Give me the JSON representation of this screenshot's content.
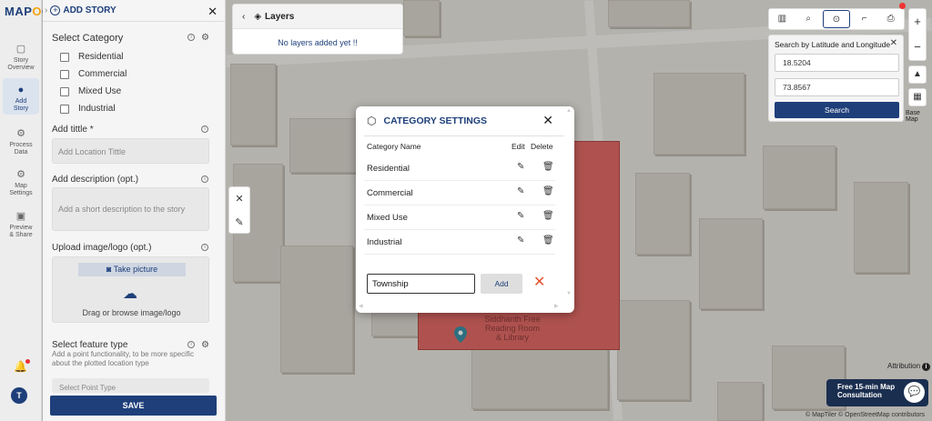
{
  "app": {
    "logo": "MAPOG",
    "logo_main": "MAP",
    "logo_accent": "O",
    "logo_tail": "G"
  },
  "rail": {
    "items": [
      {
        "label_line1": "Story",
        "label_line2": "Overview",
        "icon": "map-icon"
      },
      {
        "label_line1": "Add",
        "label_line2": "Story",
        "icon": "pin-icon",
        "active": true
      },
      {
        "label_line1": "Process",
        "label_line2": "Data",
        "icon": "gear-icon"
      },
      {
        "label_line1": "Map",
        "label_line2": "Settings",
        "icon": "settings-icon"
      },
      {
        "label_line1": "Preview",
        "label_line2": "& Share",
        "icon": "preview-icon"
      }
    ],
    "avatar_initial": "T"
  },
  "panel": {
    "title": "ADD STORY",
    "select_category": "Select Category",
    "categories": [
      "Residential",
      "Commercial",
      "Mixed Use",
      "Industrial"
    ],
    "title_label": "Add tittle *",
    "title_placeholder": "Add Location Tittle",
    "desc_label": "Add description (opt.)",
    "desc_placeholder": "Add a short description to the story",
    "upload_label": "Upload image/logo (opt.)",
    "take_picture": "Take picture",
    "drag_text": "Drag or browse image/logo",
    "feature_label": "Select feature type",
    "feature_desc": "Add a point functionality, to be more specific about the plotted location type",
    "feature_select": "Select Point Type",
    "save": "SAVE"
  },
  "layers": {
    "title": "Layers",
    "empty": "No layers added yet !!"
  },
  "latlng": {
    "title": "Search by Latitude and Longitude",
    "lat": "18.5204",
    "lng": "73.8567",
    "search": "Search"
  },
  "map": {
    "basemap_label": "Base Map",
    "attribution": "Attribution",
    "promo_line1": "Free 15-min Map",
    "promo_line2": "Consultation",
    "copyright": "© MapTiler © OpenStreetMap contributors",
    "poi_line1": "Siddhanth Free",
    "poi_line2": "Reading Room",
    "poi_line3": "& Library"
  },
  "modal": {
    "title": "CATEGORY SETTINGS",
    "col_name": "Category Name",
    "col_edit": "Edit",
    "col_delete": "Delete",
    "rows": [
      "Residential",
      "Commercial",
      "Mixed Use",
      "Industrial"
    ],
    "new_value": "Township",
    "add": "Add"
  },
  "colors": {
    "brand": "#1e3f7a",
    "accent": "#f2a30f",
    "polygon": "#e06a66",
    "cancel": "#e2522f"
  }
}
